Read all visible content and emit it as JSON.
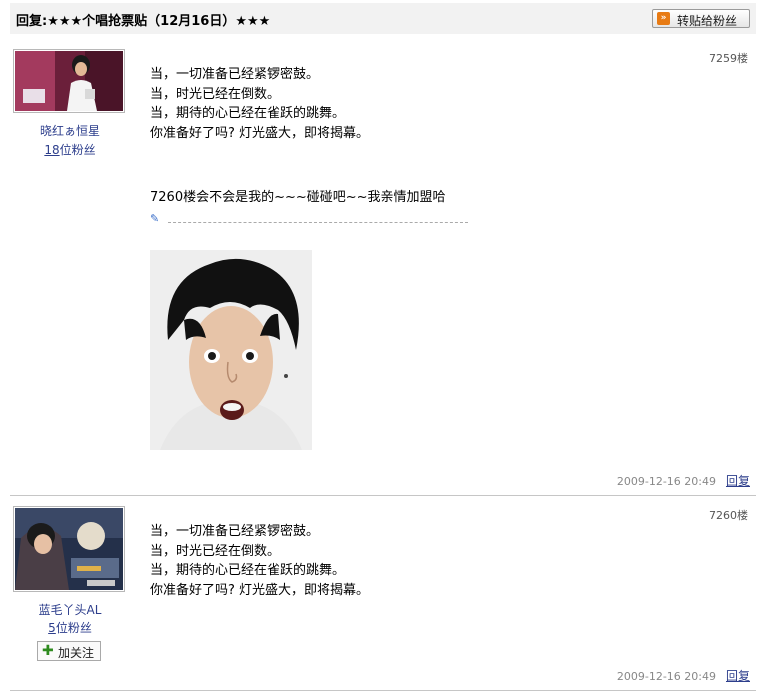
{
  "thread": {
    "title": "回复:★★★个唱抢票贴（12月16日）★★★",
    "forward_label": "转贴给粉丝"
  },
  "posts": [
    {
      "floor": "7259楼",
      "username": "晓红ぁ恒星",
      "fans_count": "18",
      "fans_suffix": "位粉丝",
      "lines": [
        "当，一切准备已经紧锣密鼓。",
        "当，时光已经在倒数。",
        "当，期待的心已经在雀跃的跳舞。",
        "你准备好了吗? 灯光盛大，即将揭幕。"
      ],
      "signature": "7260楼会不会是我的~~~碰碰吧~~我亲情加盟哈",
      "timestamp": "2009-12-16 20:49",
      "reply_label": "回复"
    },
    {
      "floor": "7260楼",
      "username": "蓝毛丫头AL",
      "fans_count": "5",
      "fans_suffix": "位粉丝",
      "follow_label": "加关注",
      "lines": [
        "当，一切准备已经紧锣密鼓。",
        "当，时光已经在倒数。",
        "当，期待的心已经在雀跃的跳舞。",
        "你准备好了吗? 灯光盛大，即将揭幕。"
      ],
      "timestamp": "2009-12-16 20:49",
      "reply_label": "回复"
    }
  ],
  "icons": {
    "forward": "forward-icon",
    "pencil": "pencil-icon",
    "plus": "plus-icon"
  },
  "colors": {
    "link": "#2d3e8c",
    "meta": "#888888",
    "topbar": "#f2f2f2",
    "forward_icon": "#e87b14",
    "plus": "#2e8b1e"
  }
}
